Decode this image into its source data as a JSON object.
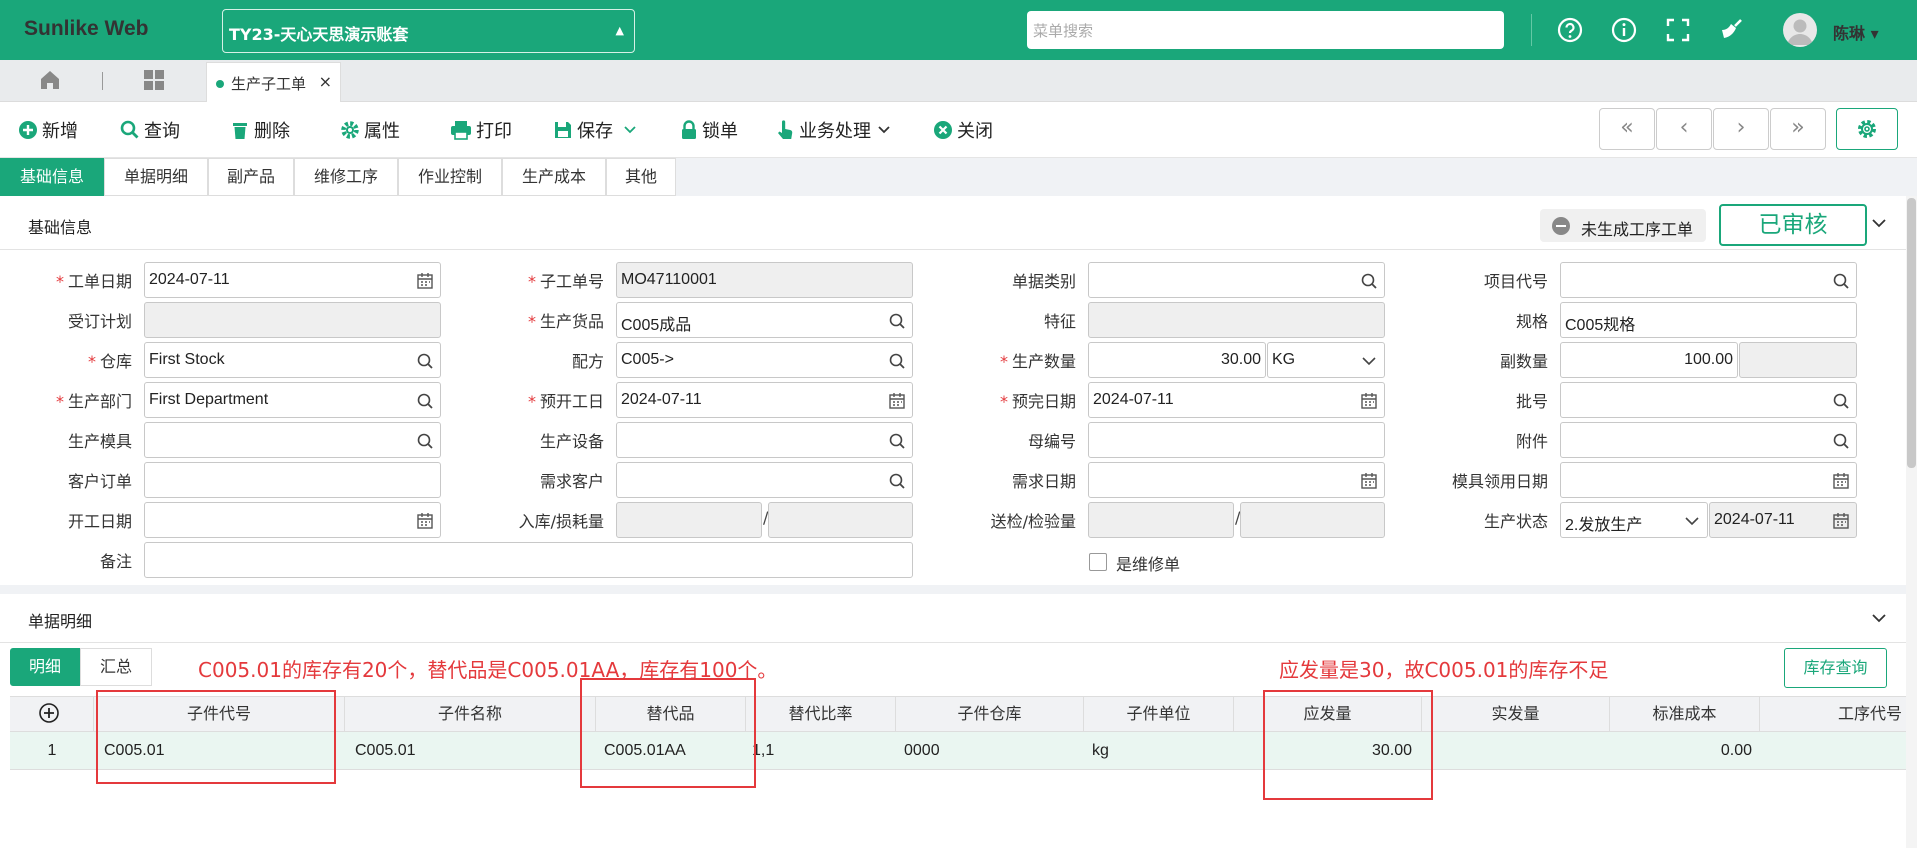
{
  "header": {
    "brand": "Sunlike Web",
    "account": "TY23-天心天思演示账套",
    "menu_search_placeholder": "菜单搜索",
    "username": "陈琳",
    "username_caret": "▾",
    "account_caret": "▲"
  },
  "tabs": {
    "doc_tab": "生产子工单",
    "close": "×"
  },
  "toolbar": {
    "new": "新增",
    "query": "查询",
    "delete": "删除",
    "props": "属性",
    "print": "打印",
    "save": "保存",
    "lock": "锁单",
    "business": "业务处理",
    "close": "关闭",
    "nav_first": "«",
    "nav_prev": "‹",
    "nav_next": "›",
    "nav_last": "»"
  },
  "section_tabs": [
    "基础信息",
    "单据明细",
    "副产品",
    "维修工序",
    "作业控制",
    "生产成本",
    "其他"
  ],
  "basic": {
    "title": "基础信息",
    "status_chip": "未生成工序工单",
    "approved": "已审核",
    "collapse": "⌄",
    "labels": {
      "work_date": "工单日期",
      "plan": "受订计划",
      "warehouse": "仓库",
      "dept": "生产部门",
      "mold": "生产模具",
      "cust_order": "客户订单",
      "start_date": "开工日期",
      "remark": "备注",
      "sub_no": "子工单号",
      "product": "生产货品",
      "formula": "配方",
      "pre_start": "预开工日",
      "device": "生产设备",
      "demand_cust": "需求客户",
      "in_loss": "入库/损耗量",
      "doc_type": "单据类别",
      "feature": "特征",
      "qty": "生产数量",
      "pre_end": "预完日期",
      "parent_no": "母编号",
      "demand_date": "需求日期",
      "inspect": "送检/检验量",
      "is_repair": "是维修单",
      "project": "项目代号",
      "spec": "规格",
      "sub_qty": "副数量",
      "batch": "批号",
      "attachment": "附件",
      "mold_date": "模具领用日期",
      "prod_status": "生产状态"
    },
    "values": {
      "work_date": "2024-07-11",
      "warehouse": "First Stock",
      "dept": "First Department",
      "sub_no": "MO47110001",
      "product": "C005成品",
      "formula": "C005->",
      "pre_start": "2024-07-11",
      "qty": "30.00",
      "unit": "KG",
      "pre_end": "2024-07-11",
      "spec": "C005规格",
      "sub_qty": "100.00",
      "prod_status": "2.发放生产",
      "status_date": "2024-07-11",
      "slash": "/"
    }
  },
  "detail": {
    "title": "单据明细",
    "sub_tabs": [
      "明细",
      "汇总"
    ],
    "stock_query": "库存查询",
    "annotation_1": "C005.01的库存有20个，替代品是C005.01AA，库存有100个。",
    "annotation_2": "应发量是30，故C005.01的库存不足",
    "columns": [
      "子件代号",
      "子件名称",
      "替代品",
      "替代比率",
      "子件仓库",
      "子件单位",
      "应发量",
      "实发量",
      "标准成本",
      "工序代号"
    ],
    "rows": [
      {
        "no": "1",
        "code": "C005.01",
        "name": "C005.01",
        "sub": "C005.01AA",
        "ratio": "1,1",
        "wh": "0000",
        "unit": "kg",
        "qty": "30.00",
        "actual": "",
        "cost": "0.00",
        "proc": ""
      }
    ]
  },
  "colors": {
    "brand": "#1aa77a",
    "danger": "#e4393c"
  }
}
